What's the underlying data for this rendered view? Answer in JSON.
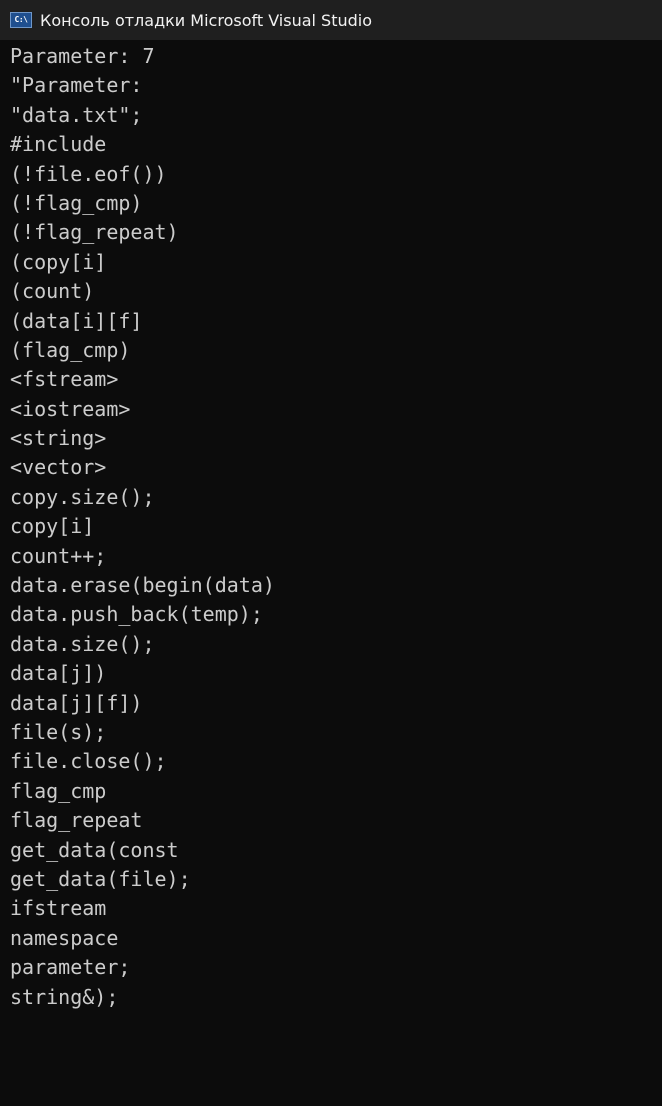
{
  "window": {
    "title": "Консоль отладки Microsoft Visual Studio",
    "icon": "console-app-icon",
    "icon_label": "C:\\",
    "colors": {
      "titlebar_bg": "#1f1f1f",
      "console_bg": "#0c0c0c",
      "console_text": "#cccccc"
    }
  },
  "console": {
    "lines": [
      "Parameter: 7",
      "\"Parameter:",
      "\"data.txt\";",
      "#include",
      "(!file.eof())",
      "(!flag_cmp)",
      "(!flag_repeat)",
      "(copy[i]",
      "(count)",
      "(data[i][f]",
      "(flag_cmp)",
      "<fstream>",
      "<iostream>",
      "<string>",
      "<vector>",
      "copy.size();",
      "copy[i]",
      "count++;",
      "data.erase(begin(data)",
      "data.push_back(temp);",
      "data.size();",
      "data[j])",
      "data[j][f])",
      "file(s);",
      "file.close();",
      "flag_cmp",
      "flag_repeat",
      "get_data(const",
      "get_data(file);",
      "ifstream",
      "namespace",
      "parameter;",
      "string&);"
    ]
  }
}
